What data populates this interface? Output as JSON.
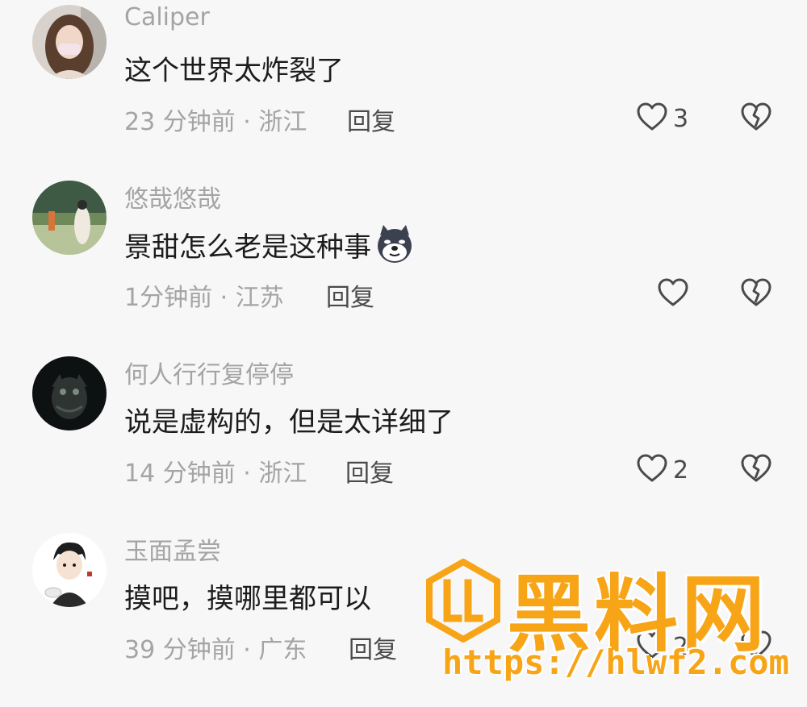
{
  "comments": [
    {
      "username": "Caliper",
      "text": "这个世界太炸裂了",
      "meta": "23 分钟前 · 浙江",
      "reply_label": "回复",
      "likes": "3"
    },
    {
      "username": "悠哉悠哉",
      "text": "景甜怎么老是这种事",
      "meta": "1分钟前 · 江苏",
      "reply_label": "回复",
      "likes": "",
      "emoji": "shiba-dog-emoji"
    },
    {
      "username": "何人行行复停停",
      "text": "说是虚构的，但是太详细了",
      "meta": "14 分钟前 · 浙江",
      "reply_label": "回复",
      "likes": "2"
    },
    {
      "username": "玉面孟尝",
      "text": "摸吧，摸哪里都可以",
      "meta": "39 分钟前 · 广东",
      "reply_label": "回复",
      "likes": "2"
    }
  ],
  "icons": {
    "like": "heart-outline-icon",
    "dislike": "broken-heart-icon"
  },
  "watermark": {
    "title": "黑料网",
    "url": "https://hlwf2.com",
    "color": "#f7a417"
  }
}
